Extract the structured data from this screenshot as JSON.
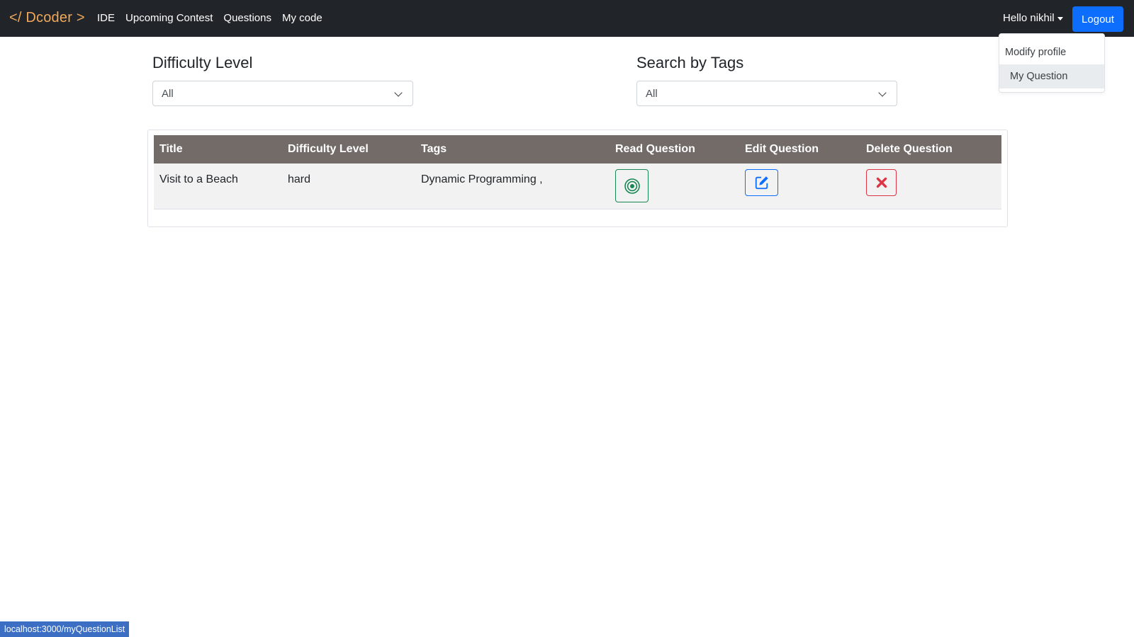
{
  "navbar": {
    "brand": "</ Dcoder >",
    "links": [
      "IDE",
      "Upcoming Contest",
      "Questions",
      "My code"
    ],
    "user_greeting": "Hello nikhil",
    "logout_label": "Logout"
  },
  "dropdown": {
    "items": [
      "Modify profile",
      "My Question"
    ],
    "active_item": "My Question"
  },
  "filters": {
    "difficulty": {
      "label": "Difficulty Level",
      "selected": "All"
    },
    "tags": {
      "label": "Search by Tags",
      "selected": "All"
    }
  },
  "table": {
    "columns": [
      "Title",
      "Difficulty Level",
      "Tags",
      "Read Question",
      "Edit Question",
      "Delete Question"
    ],
    "rows": [
      {
        "title": "Visit to a Beach",
        "difficulty": "hard",
        "tags": "Dynamic Programming ,"
      }
    ]
  },
  "icons": {
    "read": "target-icon",
    "edit": "edit-icon",
    "delete": "close-icon"
  },
  "colors": {
    "navbar_bg": "#212529",
    "brand": "#f0a85a",
    "primary": "#0d6efd",
    "success": "#198754",
    "danger": "#dc3545",
    "table_header": "#726b68"
  },
  "status_bar": {
    "url": "localhost:3000/myQuestionList"
  }
}
